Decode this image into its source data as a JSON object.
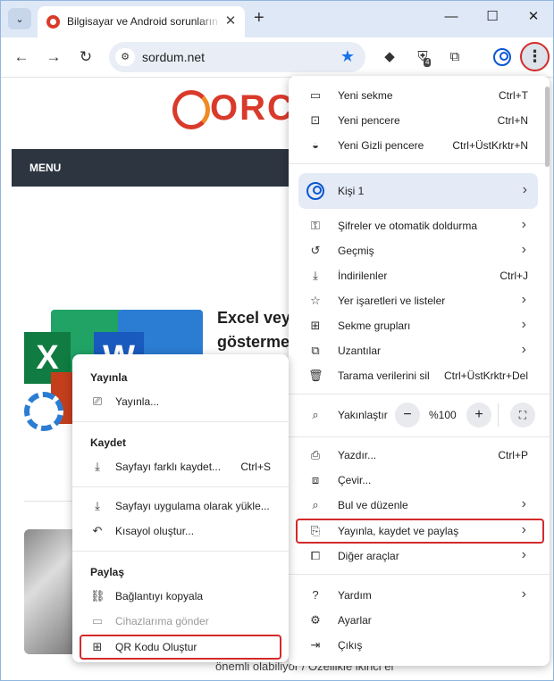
{
  "tab": {
    "title": "Bilgisayar ve Android sorunların",
    "close": "✕"
  },
  "window": {
    "minimize": "—",
    "maximize": "☐",
    "close": "✕",
    "new_tab": "+"
  },
  "toolbar": {
    "url": "sordum.net",
    "ext_badge": "4"
  },
  "page": {
    "logo_text": "ORC",
    "menu_label": "MENU",
    "article_title_line1": "Excel vey",
    "article_title_line2": "gösterme",
    "footer_text": "önemli olabiliyor / Özellikle ikinci el"
  },
  "main_menu": {
    "new_tab": {
      "label": "Yeni sekme",
      "shortcut": "Ctrl+T"
    },
    "new_window": {
      "label": "Yeni pencere",
      "shortcut": "Ctrl+N"
    },
    "incognito": {
      "label": "Yeni Gizli pencere",
      "shortcut": "Ctrl+ÜstKrktr+N"
    },
    "profile": {
      "label": "Kişi 1"
    },
    "passwords": {
      "label": "Şifreler ve otomatik doldurma"
    },
    "history": {
      "label": "Geçmiş"
    },
    "downloads": {
      "label": "İndirilenler",
      "shortcut": "Ctrl+J"
    },
    "bookmarks": {
      "label": "Yer işaretleri ve listeler"
    },
    "tab_groups": {
      "label": "Sekme grupları"
    },
    "extensions": {
      "label": "Uzantılar"
    },
    "clear_data": {
      "label": "Tarama verilerini sil",
      "shortcut": "Ctrl+ÜstKrktr+Del"
    },
    "zoom": {
      "label": "Yakınlaştır",
      "minus": "−",
      "value": "%100",
      "plus": "+"
    },
    "print": {
      "label": "Yazdır...",
      "shortcut": "Ctrl+P"
    },
    "translate": {
      "label": "Çevir..."
    },
    "find_edit": {
      "label": "Bul ve düzenle"
    },
    "cast_save_share": {
      "label": "Yayınla, kaydet ve paylaş"
    },
    "more_tools": {
      "label": "Diğer araçlar"
    },
    "help": {
      "label": "Yardım"
    },
    "settings": {
      "label": "Ayarlar"
    },
    "exit": {
      "label": "Çıkış"
    }
  },
  "sub_menu": {
    "cast_header": "Yayınla",
    "cast_item": "Yayınla...",
    "save_header": "Kaydet",
    "save_page": {
      "label": "Sayfayı farklı kaydet...",
      "shortcut": "Ctrl+S"
    },
    "install_app": "Sayfayı uygulama olarak yükle...",
    "create_shortcut": "Kısayol oluştur...",
    "share_header": "Paylaş",
    "copy_link": "Bağlantıyı kopyala",
    "send_devices": "Cihazlarıma gönder",
    "qr_code": "QR Kodu Oluştur"
  },
  "colors": {
    "highlight": "#d42a2a",
    "accent": "#0b57d0"
  }
}
